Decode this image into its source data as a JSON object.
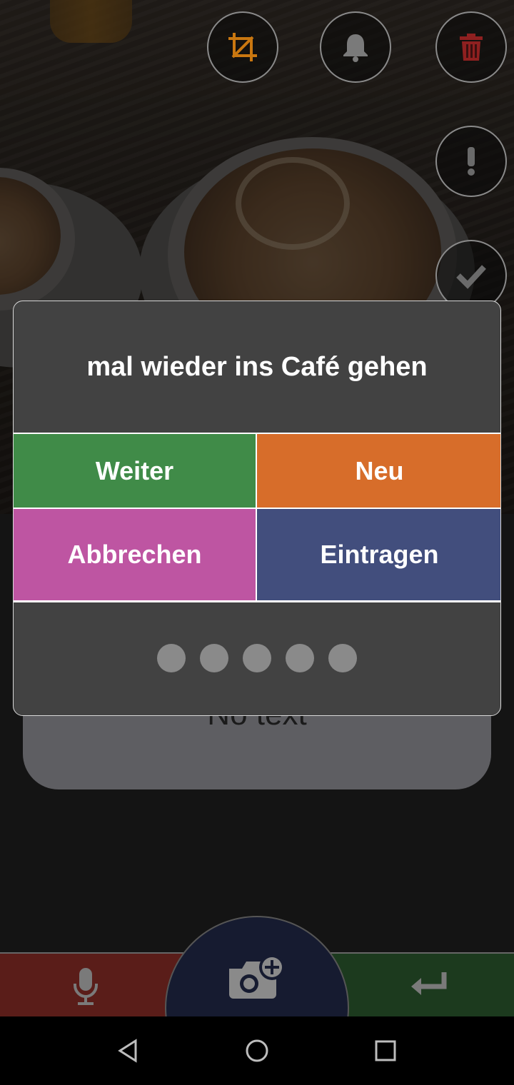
{
  "dialog": {
    "title": "mal wieder ins Café gehen",
    "buttons": {
      "continue": "Weiter",
      "new": "Neu",
      "cancel": "Abbrechen",
      "enter": "Eintragen"
    },
    "page_dots": 5
  },
  "text_card": {
    "text": "No text"
  },
  "top_actions": [
    {
      "name": "crop-icon",
      "color": "#c97710"
    },
    {
      "name": "bell-icon",
      "color": "#7a7a7a"
    },
    {
      "name": "trash-icon",
      "color": "#8f2020"
    }
  ],
  "side_actions": [
    {
      "name": "exclamation-icon",
      "color": "#6a6a6a"
    },
    {
      "name": "check-icon",
      "color": "#6a6a6a"
    }
  ],
  "bottom_bar": {
    "left_icon": "microphone-icon",
    "center_icon": "camera-add-icon",
    "right_icon": "enter-icon"
  },
  "colors": {
    "continue": "#408b48",
    "new": "#d76d2a",
    "cancel": "#be55a2",
    "enter": "#424e7d",
    "dialog_bg": "#424242"
  },
  "system_nav": [
    "back-icon",
    "home-icon",
    "recents-icon"
  ]
}
